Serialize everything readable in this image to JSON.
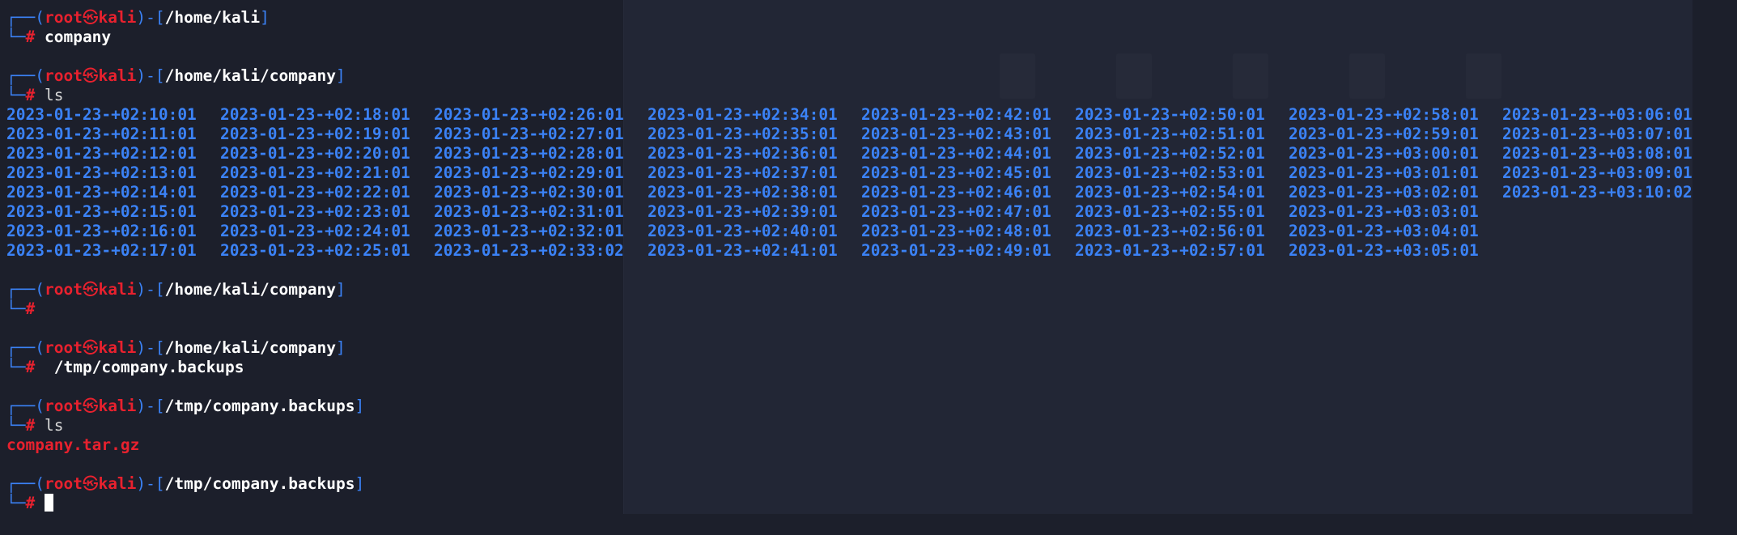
{
  "prompt": {
    "user": "root",
    "at": "㉿",
    "host": "kali",
    "symbol": "#"
  },
  "blocks": [
    {
      "path": "/home/kali",
      "command": "company"
    },
    {
      "path": "/home/kali/company",
      "command": "ls"
    },
    {
      "path": "/home/kali/company",
      "command": ""
    },
    {
      "path": "/home/kali/company",
      "command": " /tmp/company.backups"
    },
    {
      "path": "/tmp/company.backups",
      "command": "ls"
    },
    {
      "path": "/tmp/company.backups",
      "command": ""
    }
  ],
  "ls_dirs": [
    "2023-01-23-+02:10:01",
    "2023-01-23-+02:11:01",
    "2023-01-23-+02:12:01",
    "2023-01-23-+02:13:01",
    "2023-01-23-+02:14:01",
    "2023-01-23-+02:15:01",
    "2023-01-23-+02:16:01",
    "2023-01-23-+02:17:01",
    "2023-01-23-+02:18:01",
    "2023-01-23-+02:19:01",
    "2023-01-23-+02:20:01",
    "2023-01-23-+02:21:01",
    "2023-01-23-+02:22:01",
    "2023-01-23-+02:23:01",
    "2023-01-23-+02:24:01",
    "2023-01-23-+02:25:01",
    "2023-01-23-+02:26:01",
    "2023-01-23-+02:27:01",
    "2023-01-23-+02:28:01",
    "2023-01-23-+02:29:01",
    "2023-01-23-+02:30:01",
    "2023-01-23-+02:31:01",
    "2023-01-23-+02:32:01",
    "2023-01-23-+02:33:02",
    "2023-01-23-+02:34:01",
    "2023-01-23-+02:35:01",
    "2023-01-23-+02:36:01",
    "2023-01-23-+02:37:01",
    "2023-01-23-+02:38:01",
    "2023-01-23-+02:39:01",
    "2023-01-23-+02:40:01",
    "2023-01-23-+02:41:01",
    "2023-01-23-+02:42:01",
    "2023-01-23-+02:43:01",
    "2023-01-23-+02:44:01",
    "2023-01-23-+02:45:01",
    "2023-01-23-+02:46:01",
    "2023-01-23-+02:47:01",
    "2023-01-23-+02:48:01",
    "2023-01-23-+02:49:01",
    "2023-01-23-+02:50:01",
    "2023-01-23-+02:51:01",
    "2023-01-23-+02:52:01",
    "2023-01-23-+02:53:01",
    "2023-01-23-+02:54:01",
    "2023-01-23-+02:55:01",
    "2023-01-23-+02:56:01",
    "2023-01-23-+02:57:01",
    "2023-01-23-+02:58:01",
    "2023-01-23-+02:59:01",
    "2023-01-23-+03:00:01",
    "2023-01-23-+03:01:01",
    "2023-01-23-+03:02:01",
    "2023-01-23-+03:03:01",
    "2023-01-23-+03:04:01",
    "2023-01-23-+03:05:01",
    "2023-01-23-+03:06:01",
    "2023-01-23-+03:07:01",
    "2023-01-23-+03:08:01",
    "2023-01-23-+03:09:01",
    "2023-01-23-+03:10:02"
  ],
  "ls_backups": [
    "company.tar.gz"
  ],
  "colors": {
    "background": "#1c1f2b",
    "prompt_box": "#3b82f6",
    "user_host": "#e8212e",
    "directory": "#3b82f6",
    "archive": "#e8212e",
    "text": "#ffffff"
  }
}
